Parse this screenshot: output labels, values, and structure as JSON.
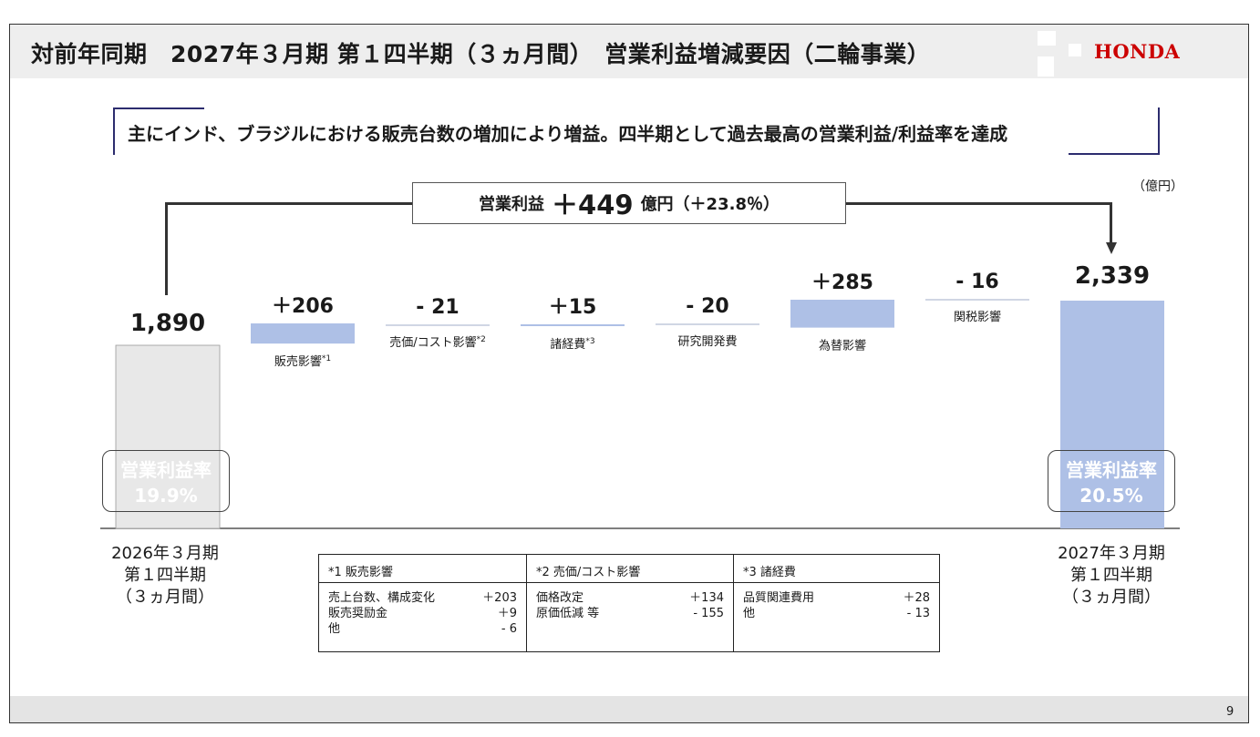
{
  "header": {
    "title": "対前年同期　2027年３月期 第１四半期（３ヵ月間）　営業利益増減要因（二輪事業）",
    "logo": "HONDA"
  },
  "headline": "主にインド、ブラジルにおける販売台数の増加により増益。四半期として過去最高の営業利益/利益率を達成",
  "unit": "（億円）",
  "summary": {
    "label": "営業利益",
    "value": "＋449",
    "suffix": "億円（＋23.8％）"
  },
  "chart_data": {
    "type": "bar",
    "subtype": "waterfall",
    "title": "",
    "xlabel": "",
    "ylabel": "",
    "categories": [
      "2026年３月期 第１四半期 （３ヵ月間）",
      "販売影響*1",
      "売価/コスト影響*2",
      "諸経費*3",
      "研究開発費",
      "為替影響",
      "関税影響",
      "2027年３月期 第１四半期 （３ヵ月間）"
    ],
    "values": [
      1890,
      206,
      -21,
      15,
      -20,
      285,
      -16,
      2339
    ],
    "value_labels": [
      "1,890",
      "＋206",
      "- 21",
      "＋15",
      "- 20",
      "＋285",
      "- 16",
      "2,339"
    ],
    "bar_kind": [
      "total",
      "delta",
      "delta",
      "delta",
      "delta",
      "delta",
      "delta",
      "total"
    ],
    "colors": {
      "start_total": "#e8e8e8",
      "end_total": "#aec0e6",
      "positive": "#aec0e6",
      "negative_line": "#d0d6e4"
    }
  },
  "bars": [
    {
      "label": "",
      "sup": "",
      "value_label": "1,890",
      "period_lines": [
        "2026年３月期",
        "第１四半期",
        "（３ヵ月間）"
      ]
    },
    {
      "label": "販売影響",
      "sup": "*1",
      "value_label": "＋206"
    },
    {
      "label": "売価/コスト影響",
      "sup": "*2",
      "value_label": "- 21"
    },
    {
      "label": "諸経費",
      "sup": "*3",
      "value_label": "＋15"
    },
    {
      "label": "研究開発費",
      "sup": "",
      "value_label": "- 20"
    },
    {
      "label": "為替影響",
      "sup": "",
      "value_label": "＋285"
    },
    {
      "label": "関税影響",
      "sup": "",
      "value_label": "- 16"
    },
    {
      "label": "",
      "sup": "",
      "value_label": "2,339",
      "period_lines": [
        "2027年３月期",
        "第１四半期",
        "（３ヵ月間）"
      ]
    }
  ],
  "rates": {
    "left": {
      "label": "営業利益率",
      "value": "19.9%",
      "color": "#8a8a8a"
    },
    "right": {
      "label": "営業利益率",
      "value": "20.5%",
      "color": "#1c3a60"
    }
  },
  "notes": [
    {
      "title": "*1 販売影響",
      "rows": [
        {
          "k": "売上台数、構成変化",
          "v": "＋203"
        },
        {
          "k": "販売奨励金",
          "v": "＋9"
        },
        {
          "k": "他",
          "v": "- 6"
        }
      ]
    },
    {
      "title": "*2 売価/コスト影響",
      "rows": [
        {
          "k": "価格改定",
          "v": "＋134"
        },
        {
          "k": "原価低減 等",
          "v": "- 155"
        }
      ]
    },
    {
      "title": "*3 諸経費",
      "rows": [
        {
          "k": "品質関連費用",
          "v": "＋28"
        },
        {
          "k": "他",
          "v": "- 13"
        }
      ]
    }
  ],
  "page_number": "9"
}
